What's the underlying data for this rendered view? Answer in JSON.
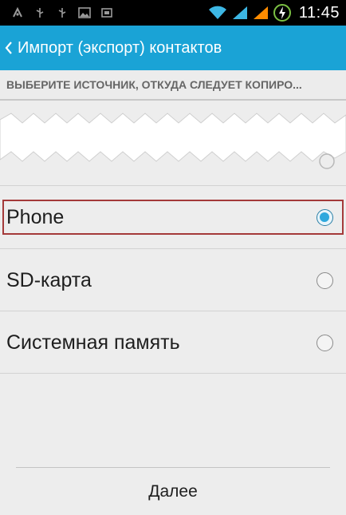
{
  "status_bar": {
    "left_icons": [
      "usb-debug-icon",
      "usb-icon",
      "usb-icon",
      "image-notification-icon",
      "sd-card-icon"
    ],
    "right_icons": [
      "wifi-icon",
      "signal-icon",
      "signal-icon",
      "battery-charging-icon"
    ],
    "time": "11:45",
    "colors": {
      "wifi": "#3db7e4",
      "signal_1": "#3db7e4",
      "signal_2": "#ff8c00",
      "battery": "#7bc043"
    }
  },
  "action_bar": {
    "back_icon": "chevron-left-icon",
    "title": "Импорт (экспорт) контактов",
    "color": "#1aa3d6"
  },
  "section": {
    "title": "ВЫБЕРИТЕ ИСТОЧНИК, ОТКУДА СЛЕДУЕТ КОПИРО..."
  },
  "options": [
    {
      "label": "Phone",
      "selected": true
    },
    {
      "label": "SD-карта",
      "selected": false
    },
    {
      "label": "Системная память",
      "selected": false
    }
  ],
  "footer": {
    "next_label": "Далее"
  }
}
